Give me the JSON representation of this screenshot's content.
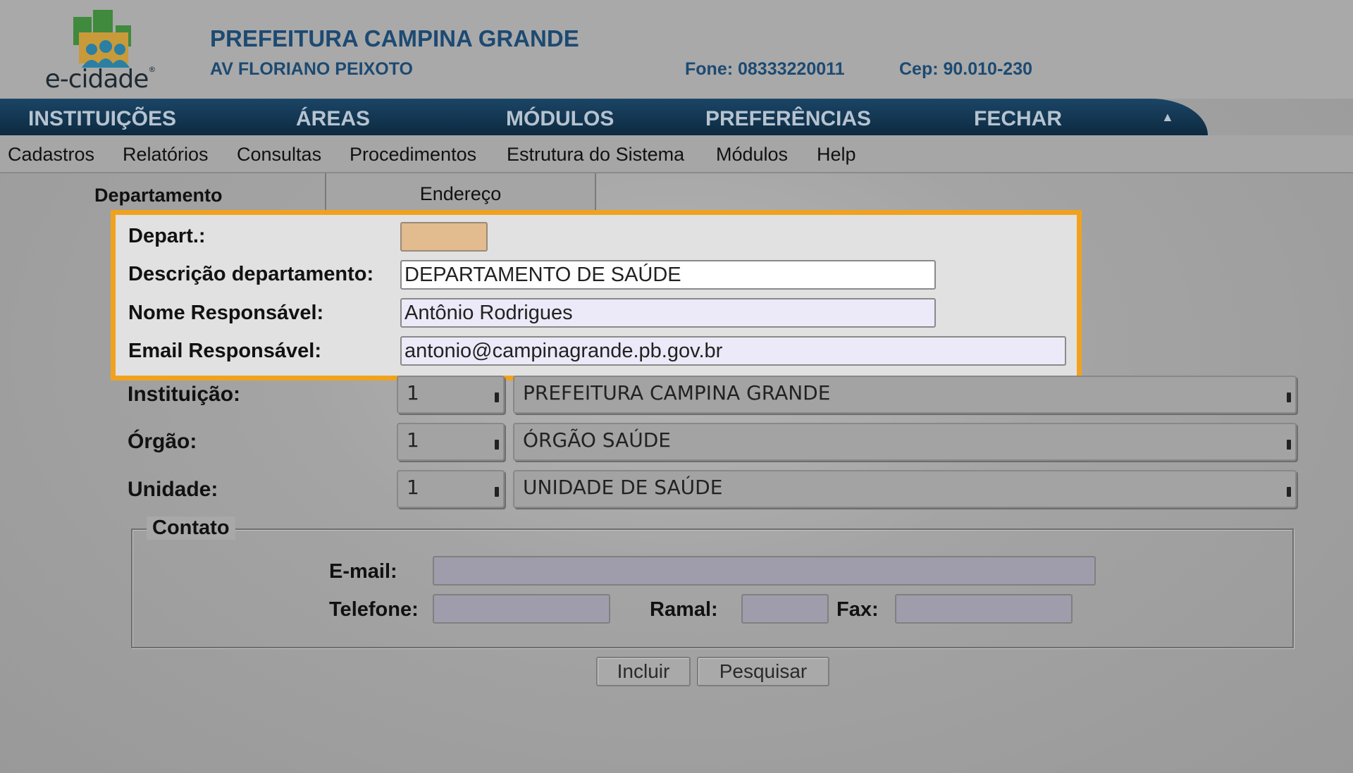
{
  "header": {
    "logo_text": "e-cidade",
    "logo_mark": "®",
    "org_name": "PREFEITURA CAMPINA GRANDE",
    "address": "AV FLORIANO PEIXOTO",
    "phone": "Fone: 08333220011",
    "cep": "Cep: 90.010-230"
  },
  "topnav": {
    "items": [
      "INSTITUIÇÕES",
      "ÁREAS",
      "MÓDULOS",
      "PREFERÊNCIAS",
      "FECHAR"
    ],
    "collapse_icon": "▲"
  },
  "menubar": {
    "items": [
      "Cadastros",
      "Relatórios",
      "Consultas",
      "Procedimentos",
      "Estrutura do Sistema",
      "Módulos",
      "Help"
    ]
  },
  "tabs": {
    "active": "Departamento",
    "inactive": "Endereço"
  },
  "form": {
    "depart_label": "Depart.:",
    "depart_value": "",
    "descricao_label": "Descrição departamento:",
    "descricao_value": "DEPARTAMENTO DE SAÚDE",
    "nome_label": "Nome Responsável:",
    "nome_value": "Antônio Rodrigues",
    "email_label": "Email Responsável:",
    "email_value": "antonio@campinagrande.pb.gov.br",
    "instituicao_label": "Instituição:",
    "instituicao_code": "1",
    "instituicao_name": "PREFEITURA CAMPINA GRANDE",
    "orgao_label": "Órgão:",
    "orgao_code": "1",
    "orgao_name": "ÓRGÃO SAÚDE",
    "unidade_label": "Unidade:",
    "unidade_code": "1",
    "unidade_name": "UNIDADE DE SAÚDE"
  },
  "contato": {
    "legend": "Contato",
    "email_label": "E-mail:",
    "email_value": "",
    "telefone_label": "Telefone:",
    "telefone_value": "",
    "ramal_label": "Ramal:",
    "ramal_value": "",
    "fax_label": "Fax:",
    "fax_value": ""
  },
  "buttons": {
    "incluir": "Incluir",
    "pesquisar": "Pesquisar"
  },
  "colors": {
    "highlight_border": "#f0a21f",
    "nav_background": "#1b4566",
    "header_text": "#1c4a72"
  }
}
